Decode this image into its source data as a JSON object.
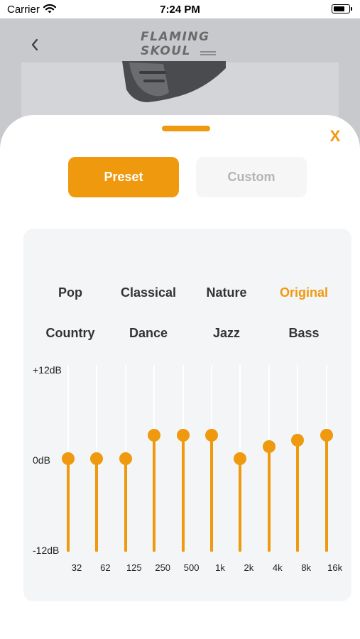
{
  "status_bar": {
    "carrier": "Carrier",
    "time": "7:24 PM",
    "wifi_icon": "wifi-icon",
    "battery_icon": "battery-icon"
  },
  "background": {
    "back_icon": "chevron-left-icon",
    "logo_line1": "FLAMING",
    "logo_line2": "SKOUL"
  },
  "sheet": {
    "close_label": "X",
    "tabs": [
      {
        "label": "Preset",
        "active": true
      },
      {
        "label": "Custom",
        "active": false
      }
    ],
    "presets": [
      {
        "label": "Pop",
        "active": false
      },
      {
        "label": "Classical",
        "active": false
      },
      {
        "label": "Nature",
        "active": false
      },
      {
        "label": "Original",
        "active": true
      },
      {
        "label": "Country",
        "active": false
      },
      {
        "label": "Dance",
        "active": false
      },
      {
        "label": "Jazz",
        "active": false
      },
      {
        "label": "Bass",
        "active": false
      }
    ],
    "db_labels": {
      "max": "+12dB",
      "mid": "0dB",
      "min": "-12dB"
    },
    "db_range": [
      -12,
      12
    ],
    "bands": [
      {
        "freq": "32",
        "gain_db": 0
      },
      {
        "freq": "62",
        "gain_db": 0
      },
      {
        "freq": "125",
        "gain_db": 0
      },
      {
        "freq": "250",
        "gain_db": 3
      },
      {
        "freq": "500",
        "gain_db": 3
      },
      {
        "freq": "1k",
        "gain_db": 3
      },
      {
        "freq": "2k",
        "gain_db": 0
      },
      {
        "freq": "4k",
        "gain_db": 1.5
      },
      {
        "freq": "8k",
        "gain_db": 2.3
      },
      {
        "freq": "16k",
        "gain_db": 3
      }
    ]
  },
  "colors": {
    "accent": "#ef9a0e",
    "overlay_bg": "#c8c9cd",
    "card_bg": "#f4f5f7",
    "inactive_tab_text": "#b4b4b4"
  }
}
